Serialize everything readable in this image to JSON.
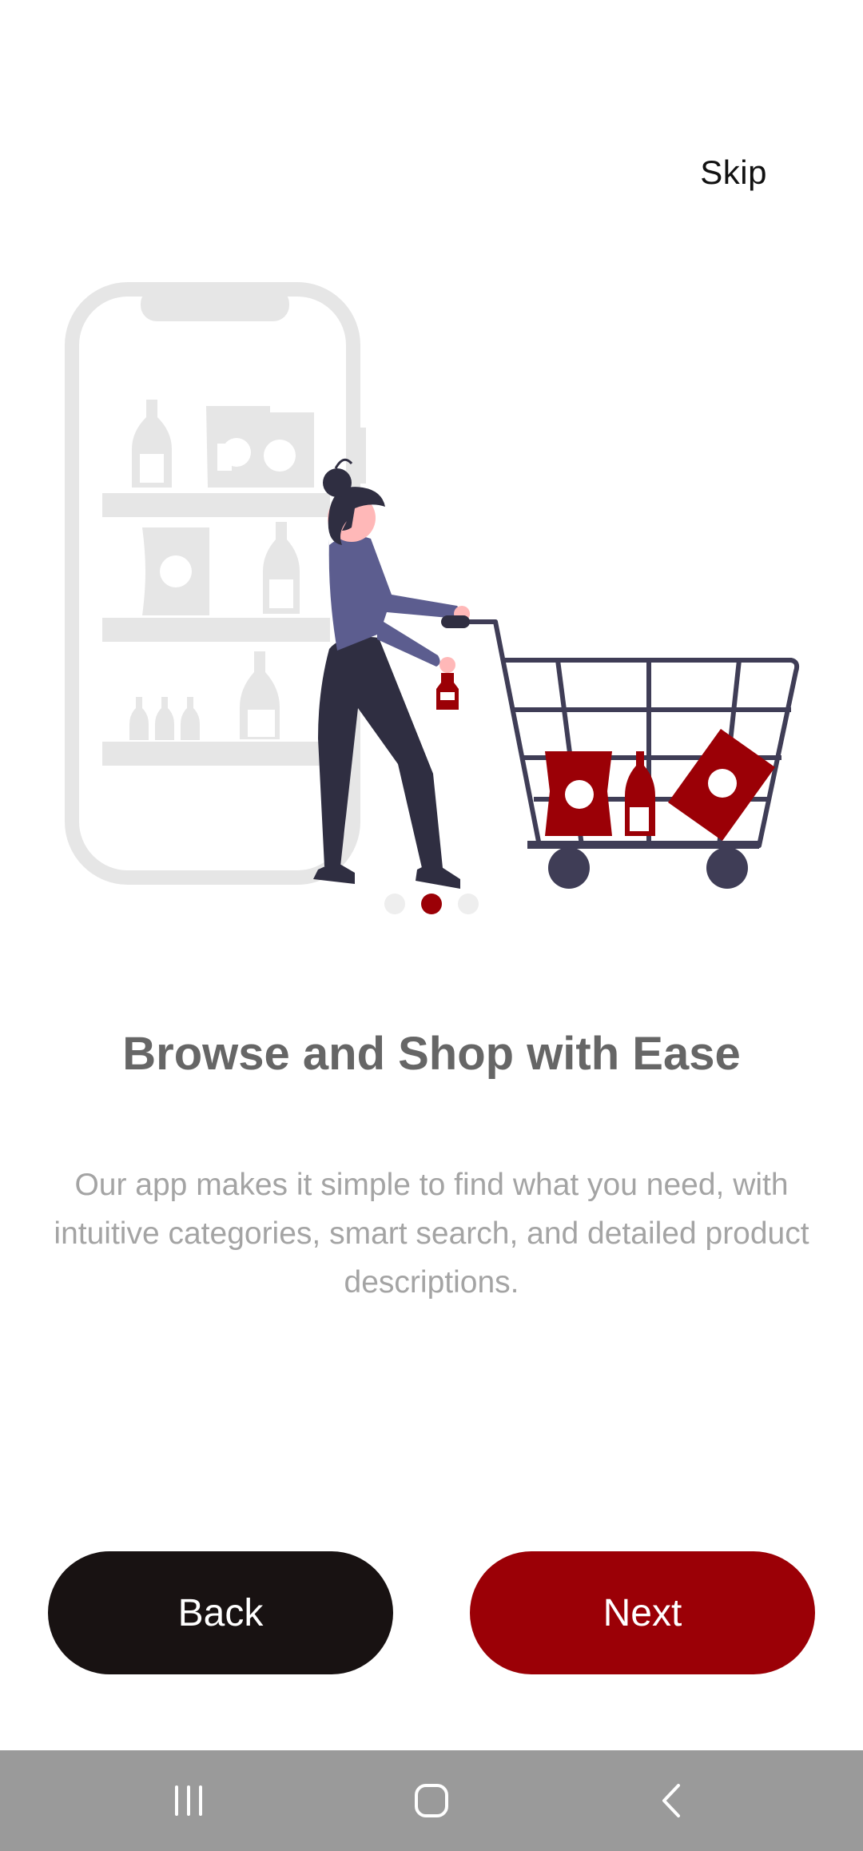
{
  "header": {
    "skip_label": "Skip"
  },
  "onboarding": {
    "title": "Browse and Shop with Ease",
    "description": "Our app makes it simple to find what you need, with intuitive categories, smart search, and detailed product descriptions.",
    "page_indicator": {
      "total": 3,
      "current": 2
    }
  },
  "actions": {
    "back_label": "Back",
    "next_label": "Next"
  },
  "navigation_bar": {
    "icons": [
      "recent-apps-icon",
      "home-icon",
      "back-icon"
    ]
  },
  "colors": {
    "accent": "#9b0006",
    "back_button": "#181212",
    "title_text": "#666666",
    "description_text": "#a4a4a4",
    "nav_bar": "#9a9a9a",
    "illustration_outline": "#e6e6e6"
  }
}
